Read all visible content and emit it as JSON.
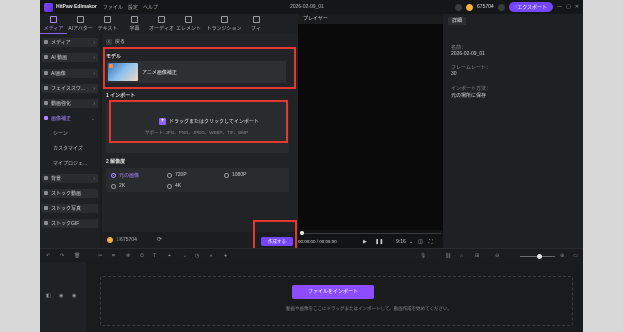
{
  "window": {
    "app_name": "HitPaw Edimakor",
    "menu": [
      "ファイル",
      "設定",
      "ヘルプ"
    ],
    "doc_title": "2026-02-09_01",
    "credits": "675704",
    "export_label": "エクスポート"
  },
  "toolbar": {
    "items": [
      {
        "label": "メディア",
        "icon": "media-icon"
      },
      {
        "label": "AIアバター",
        "icon": "avatar-icon"
      },
      {
        "label": "テキスト",
        "icon": "text-icon"
      },
      {
        "label": "字幕",
        "icon": "subtitle-icon"
      },
      {
        "label": "オーディオ",
        "icon": "audio-icon"
      },
      {
        "label": "エレメント",
        "icon": "element-icon"
      },
      {
        "label": "トランジション",
        "icon": "transition-icon"
      },
      {
        "label": "フィ",
        "icon": "filter-icon"
      }
    ]
  },
  "sidebar": {
    "items": [
      {
        "label": "メディア"
      },
      {
        "label": "AI 動画"
      },
      {
        "label": "AI画像"
      },
      {
        "label": "フェイススワ..."
      },
      {
        "label": "動画強化"
      },
      {
        "label": "画像補正"
      },
      {
        "label": "背景"
      },
      {
        "label": "ストック動画"
      },
      {
        "label": "ストック写真"
      },
      {
        "label": "ストックGIF"
      }
    ],
    "subitems": [
      "シーン",
      "カスタマイズ",
      "マイプロジェ..."
    ]
  },
  "panel": {
    "back_label": "戻る",
    "model_heading": "モデル",
    "model_name": "アニメ画像補正",
    "import_heading": "インポート",
    "import_step": "1",
    "import_button": "ドラッグまたはクリックしてインポート",
    "support_text": "サポート: JPG、PNG、JPEG、WEBP、TIF、BMP",
    "resolution_heading": "解像度",
    "resolution_step": "2",
    "resolution_options": [
      "元の画像",
      "720P",
      "1080P",
      "2K",
      "4K"
    ],
    "selected_resolution": "元の画像",
    "footer_credits_prefix": "1/",
    "footer_credits": "675704",
    "generate_label": "作成する"
  },
  "player": {
    "title": "プレイヤー",
    "time": "00:00:00 / 00:05:00",
    "ratio": "9:16"
  },
  "inspector": {
    "tab": "詳細",
    "name_label": "名前：",
    "name_value": "2026-02-09_01",
    "fps_label": "フレームレート：",
    "fps_value": "30",
    "import_method_label": "インポート方法：",
    "import_method_value": "元の場所に保存"
  },
  "timeline": {
    "file_import_label": "ファイルをインポート",
    "drop_hint": "動画や画像をここにドラッグまたはインポートして、動画作成を始めてください。"
  },
  "colors": {
    "accent": "#7546ff",
    "highlight": "#e23a2e",
    "coin": "#f4b13d"
  }
}
